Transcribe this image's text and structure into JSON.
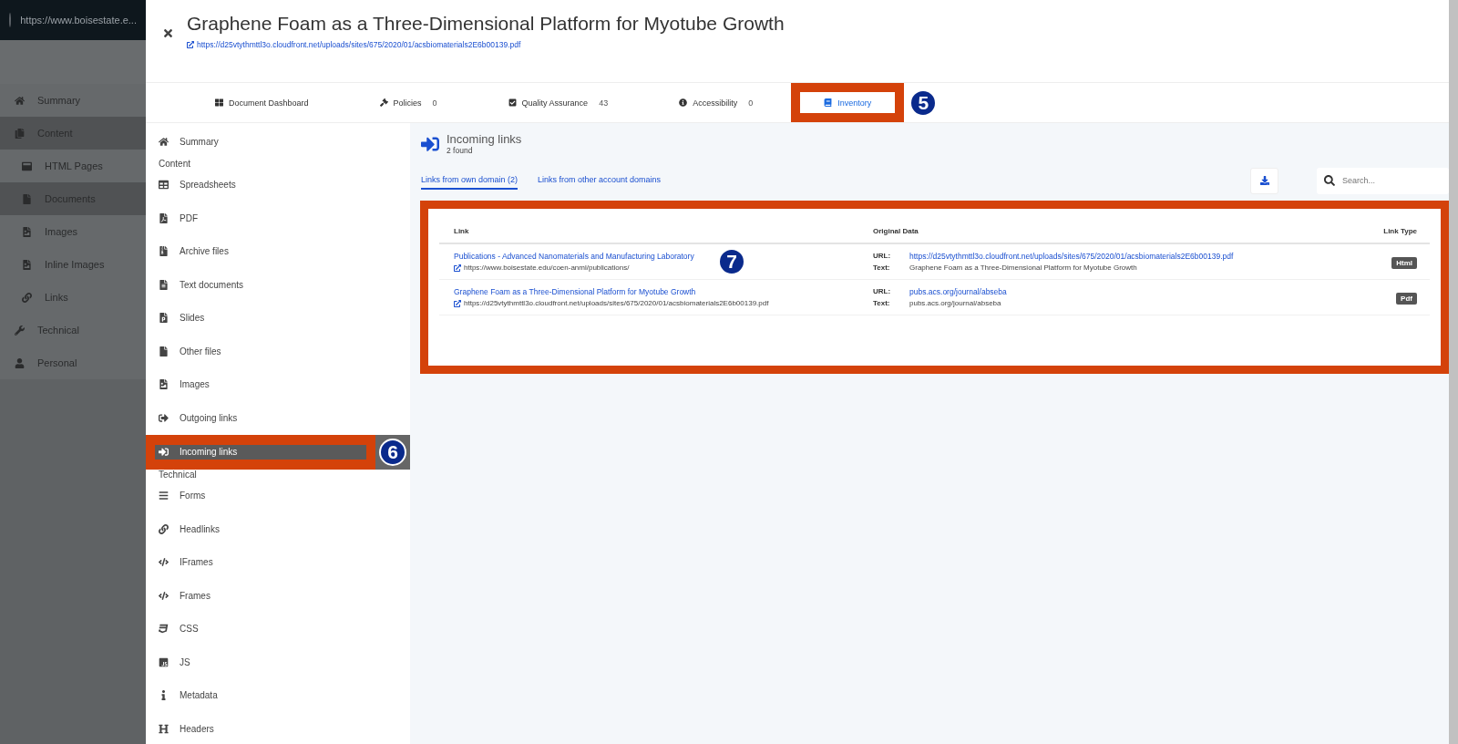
{
  "background_app": {
    "url": "https://www.boisestate.e...",
    "nav": [
      {
        "label": "Summary",
        "selected": false
      },
      {
        "label": "Content",
        "selected": true,
        "children": [
          {
            "label": "HTML Pages",
            "selected": false
          },
          {
            "label": "Documents",
            "selected": true
          },
          {
            "label": "Images",
            "selected": false
          },
          {
            "label": "Inline Images",
            "selected": false
          },
          {
            "label": "Links",
            "selected": false
          }
        ]
      },
      {
        "label": "Technical",
        "selected": false
      },
      {
        "label": "Personal",
        "selected": false
      }
    ]
  },
  "dialog": {
    "title": "Graphene Foam as a Three-Dimensional Platform for Myotube Growth",
    "url": "https://d25vtythmttl3o.cloudfront.net/uploads/sites/675/2020/01/acsbiomaterials2E6b00139.pdf",
    "tabs": [
      {
        "label": "Document Dashboard",
        "selected": false
      },
      {
        "label": "Policies",
        "count": "0",
        "selected": false
      },
      {
        "label": "Quality Assurance",
        "count": "43",
        "selected": false
      },
      {
        "label": "Accessibility",
        "count": "0",
        "selected": false
      },
      {
        "label": "Inventory",
        "selected": true,
        "callout": "5"
      }
    ],
    "sidebar": [
      {
        "items": [
          {
            "label": "Summary",
            "selected": false
          }
        ]
      },
      {
        "heading": "Content",
        "items": [
          {
            "label": "Spreadsheets",
            "selected": false
          },
          {
            "label": "PDF",
            "selected": false
          },
          {
            "label": "Archive files",
            "selected": false
          },
          {
            "label": "Text documents",
            "selected": false
          },
          {
            "label": "Slides",
            "selected": false
          },
          {
            "label": "Other files",
            "selected": false
          },
          {
            "label": "Images",
            "selected": false
          },
          {
            "label": "Outgoing links",
            "selected": false
          },
          {
            "label": "Incoming links",
            "selected": true,
            "callout": "6"
          }
        ]
      },
      {
        "heading": "Technical",
        "items": [
          {
            "label": "Forms",
            "selected": false
          },
          {
            "label": "Headlinks",
            "selected": false
          },
          {
            "label": "IFrames",
            "selected": false
          },
          {
            "label": "Frames",
            "selected": false
          },
          {
            "label": "CSS",
            "selected": false
          },
          {
            "label": "JS",
            "selected": false
          },
          {
            "label": "Metadata",
            "selected": false
          },
          {
            "label": "Headers",
            "selected": false
          }
        ]
      }
    ],
    "panel": {
      "title": "Incoming links",
      "subtitle": "2 found",
      "subtabs": [
        {
          "label": "Links from own domain (2)",
          "selected": true
        },
        {
          "label": "Links from other account domains",
          "selected": false
        }
      ],
      "search": {
        "placeholder": "Search..."
      },
      "table": {
        "callout": "7",
        "columns": [
          "Link",
          "Original Data",
          "Link Type"
        ],
        "rows": [
          {
            "title": "Publications - Advanced Nanomaterials and Manufacturing Laboratory",
            "url": "https://www.boisestate.edu/coen-anml/publications/",
            "data": [
              {
                "label": "URL:",
                "value": "https://d25vtythmttl3o.cloudfront.net/uploads/sites/675/2020/01/acsbiomaterials2E6b00139.pdf",
                "kind": "link"
              },
              {
                "label": "Text:",
                "value": "Graphene Foam as a Three-Dimensional Platform for Myotube Growth",
                "kind": "text"
              }
            ],
            "type": "Html"
          },
          {
            "title": "Graphene Foam as a Three-Dimensional Platform for Myotube Growth",
            "url": "https://d25vtythmttl3o.cloudfront.net/uploads/sites/675/2020/01/acsbiomaterials2E6b00139.pdf",
            "data": [
              {
                "label": "URL:",
                "value": "pubs.acs.org/journal/abseba",
                "kind": "link"
              },
              {
                "label": "Text:",
                "value": "pubs.acs.org/journal/abseba",
                "kind": "text"
              }
            ],
            "type": "Pdf"
          }
        ]
      }
    }
  }
}
